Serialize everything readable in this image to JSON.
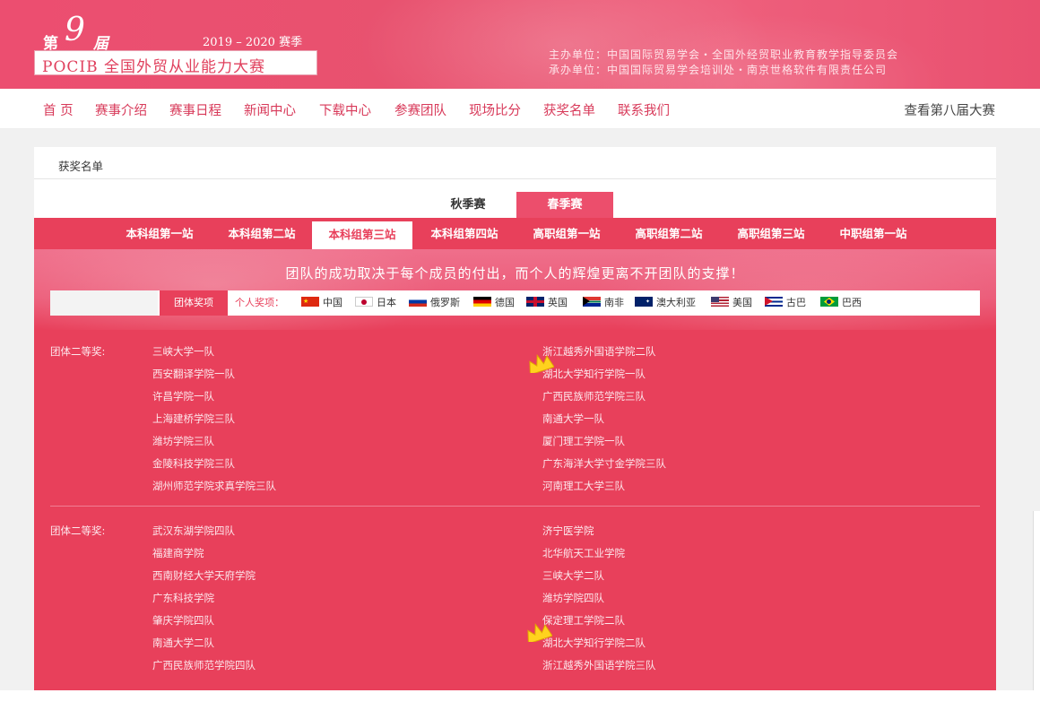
{
  "header": {
    "edition_prefix": "第",
    "edition_number": "9",
    "edition_suffix": "届",
    "season": "2019 – 2020 赛季",
    "logo_text": "POCIB 全国外贸从业能力大赛",
    "organizer": "主办单位：中国国际贸易学会・全国外经贸职业教育教学指导委员会",
    "co_organizer": "承办单位：中国国际贸易学会培训处・南京世格软件有限责任公司"
  },
  "nav": {
    "items": [
      "首 页",
      "赛事介绍",
      "赛事日程",
      "新闻中心",
      "下载中心",
      "参赛团队",
      "现场比分",
      "获奖名单",
      "联系我们"
    ],
    "right_link": "查看第八届大赛"
  },
  "breadcrumb": "获奖名单",
  "season_tabs": [
    "秋季赛",
    "春季赛"
  ],
  "active_season_tab": "春季赛",
  "stage_tabs": [
    "本科组第一站",
    "本科组第二站",
    "本科组第三站",
    "本科组第四站",
    "高职组第一站",
    "高职组第二站",
    "高职组第三站",
    "中职组第一站"
  ],
  "active_stage_tab": "本科组第三站",
  "motto": "团队的成功取决于每个成员的付出，而个人的辉煌更离不开团队的支撑！",
  "filter": {
    "team_label": "团体奖项",
    "personal_label": "个人奖项：",
    "countries": [
      {
        "name": "中国",
        "flag": "cn-flag"
      },
      {
        "name": "日本",
        "flag": "jp-flag"
      },
      {
        "name": "俄罗斯",
        "flag": "ru-flag"
      },
      {
        "name": "德国",
        "flag": "de-flag"
      },
      {
        "name": "英国",
        "flag": "uk-flag"
      },
      {
        "name": "南非",
        "flag": "za-flag"
      },
      {
        "name": "澳大利亚",
        "flag": "au-flag"
      },
      {
        "name": "美国",
        "flag": "us-flag"
      },
      {
        "name": "古巴",
        "flag": "cu-flag"
      },
      {
        "name": "巴西",
        "flag": "br-flag"
      }
    ]
  },
  "awards": [
    {
      "category": "团体二等奖:",
      "left": [
        "三峡大学一队",
        "西安翻译学院一队",
        "许昌学院一队",
        "上海建桥学院三队",
        "潍坊学院三队",
        "金陵科技学院三队",
        "湖州师范学院求真学院三队"
      ],
      "right": [
        "浙江越秀外国语学院二队",
        "湖北大学知行学院一队",
        "广西民族师范学院三队",
        "南通大学一队",
        "厦门理工学院一队",
        "广东海洋大学寸金学院三队",
        "河南理工大学三队"
      ]
    },
    {
      "category": "团体二等奖:",
      "left": [
        "武汉东湖学院四队",
        "福建商学院",
        "西南财经大学天府学院",
        "广东科技学院",
        "肇庆学院四队",
        "南通大学二队",
        "广西民族师范学院四队"
      ],
      "right": [
        "济宁医学院",
        "北华航天工业学院",
        "三峡大学二队",
        "潍坊学院四队",
        "保定理工学院二队",
        "湖北大学知行学院二队",
        "浙江越秀外国语学院三队"
      ]
    }
  ],
  "colors": {
    "brand": "#e8405b",
    "header": "#ec4e70",
    "crown": "#ffd21e"
  }
}
